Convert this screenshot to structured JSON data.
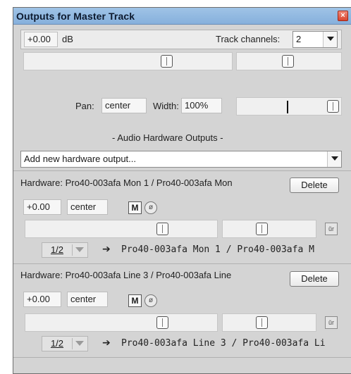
{
  "window": {
    "title": "Outputs for Master Track",
    "close_symbol": "×"
  },
  "master": {
    "volume": "+0.00",
    "volume_unit": "dB",
    "track_channels_label": "Track channels:",
    "track_channels_value": "2",
    "pan_label": "Pan:",
    "pan_value": "center",
    "width_label": "Width:",
    "width_value": "100%"
  },
  "hw_section": {
    "heading": "- Audio Hardware Outputs -",
    "add_select": "Add new hardware output..."
  },
  "outputs": [
    {
      "title": "Hardware: Pro40-003afa Mon 1 / Pro40-003afa Mon",
      "delete_label": "Delete",
      "volume": "+0.00",
      "pan": "center",
      "mute_label": "M",
      "phase_symbol": "ø",
      "channels": "1/2",
      "route_arrow": "➔",
      "destination": "Pro40-003afa Mon 1 / Pro40-003afa M"
    },
    {
      "title": "Hardware: Pro40-003afa Line 3 / Pro40-003afa Line",
      "delete_label": "Delete",
      "volume": "+0.00",
      "pan": "center",
      "mute_label": "M",
      "phase_symbol": "ø",
      "channels": "1/2",
      "route_arrow": "➔",
      "destination": "Pro40-003afa Line 3 / Pro40-003afa Li"
    }
  ],
  "icons": {
    "mono_stereo": "ŭr"
  }
}
